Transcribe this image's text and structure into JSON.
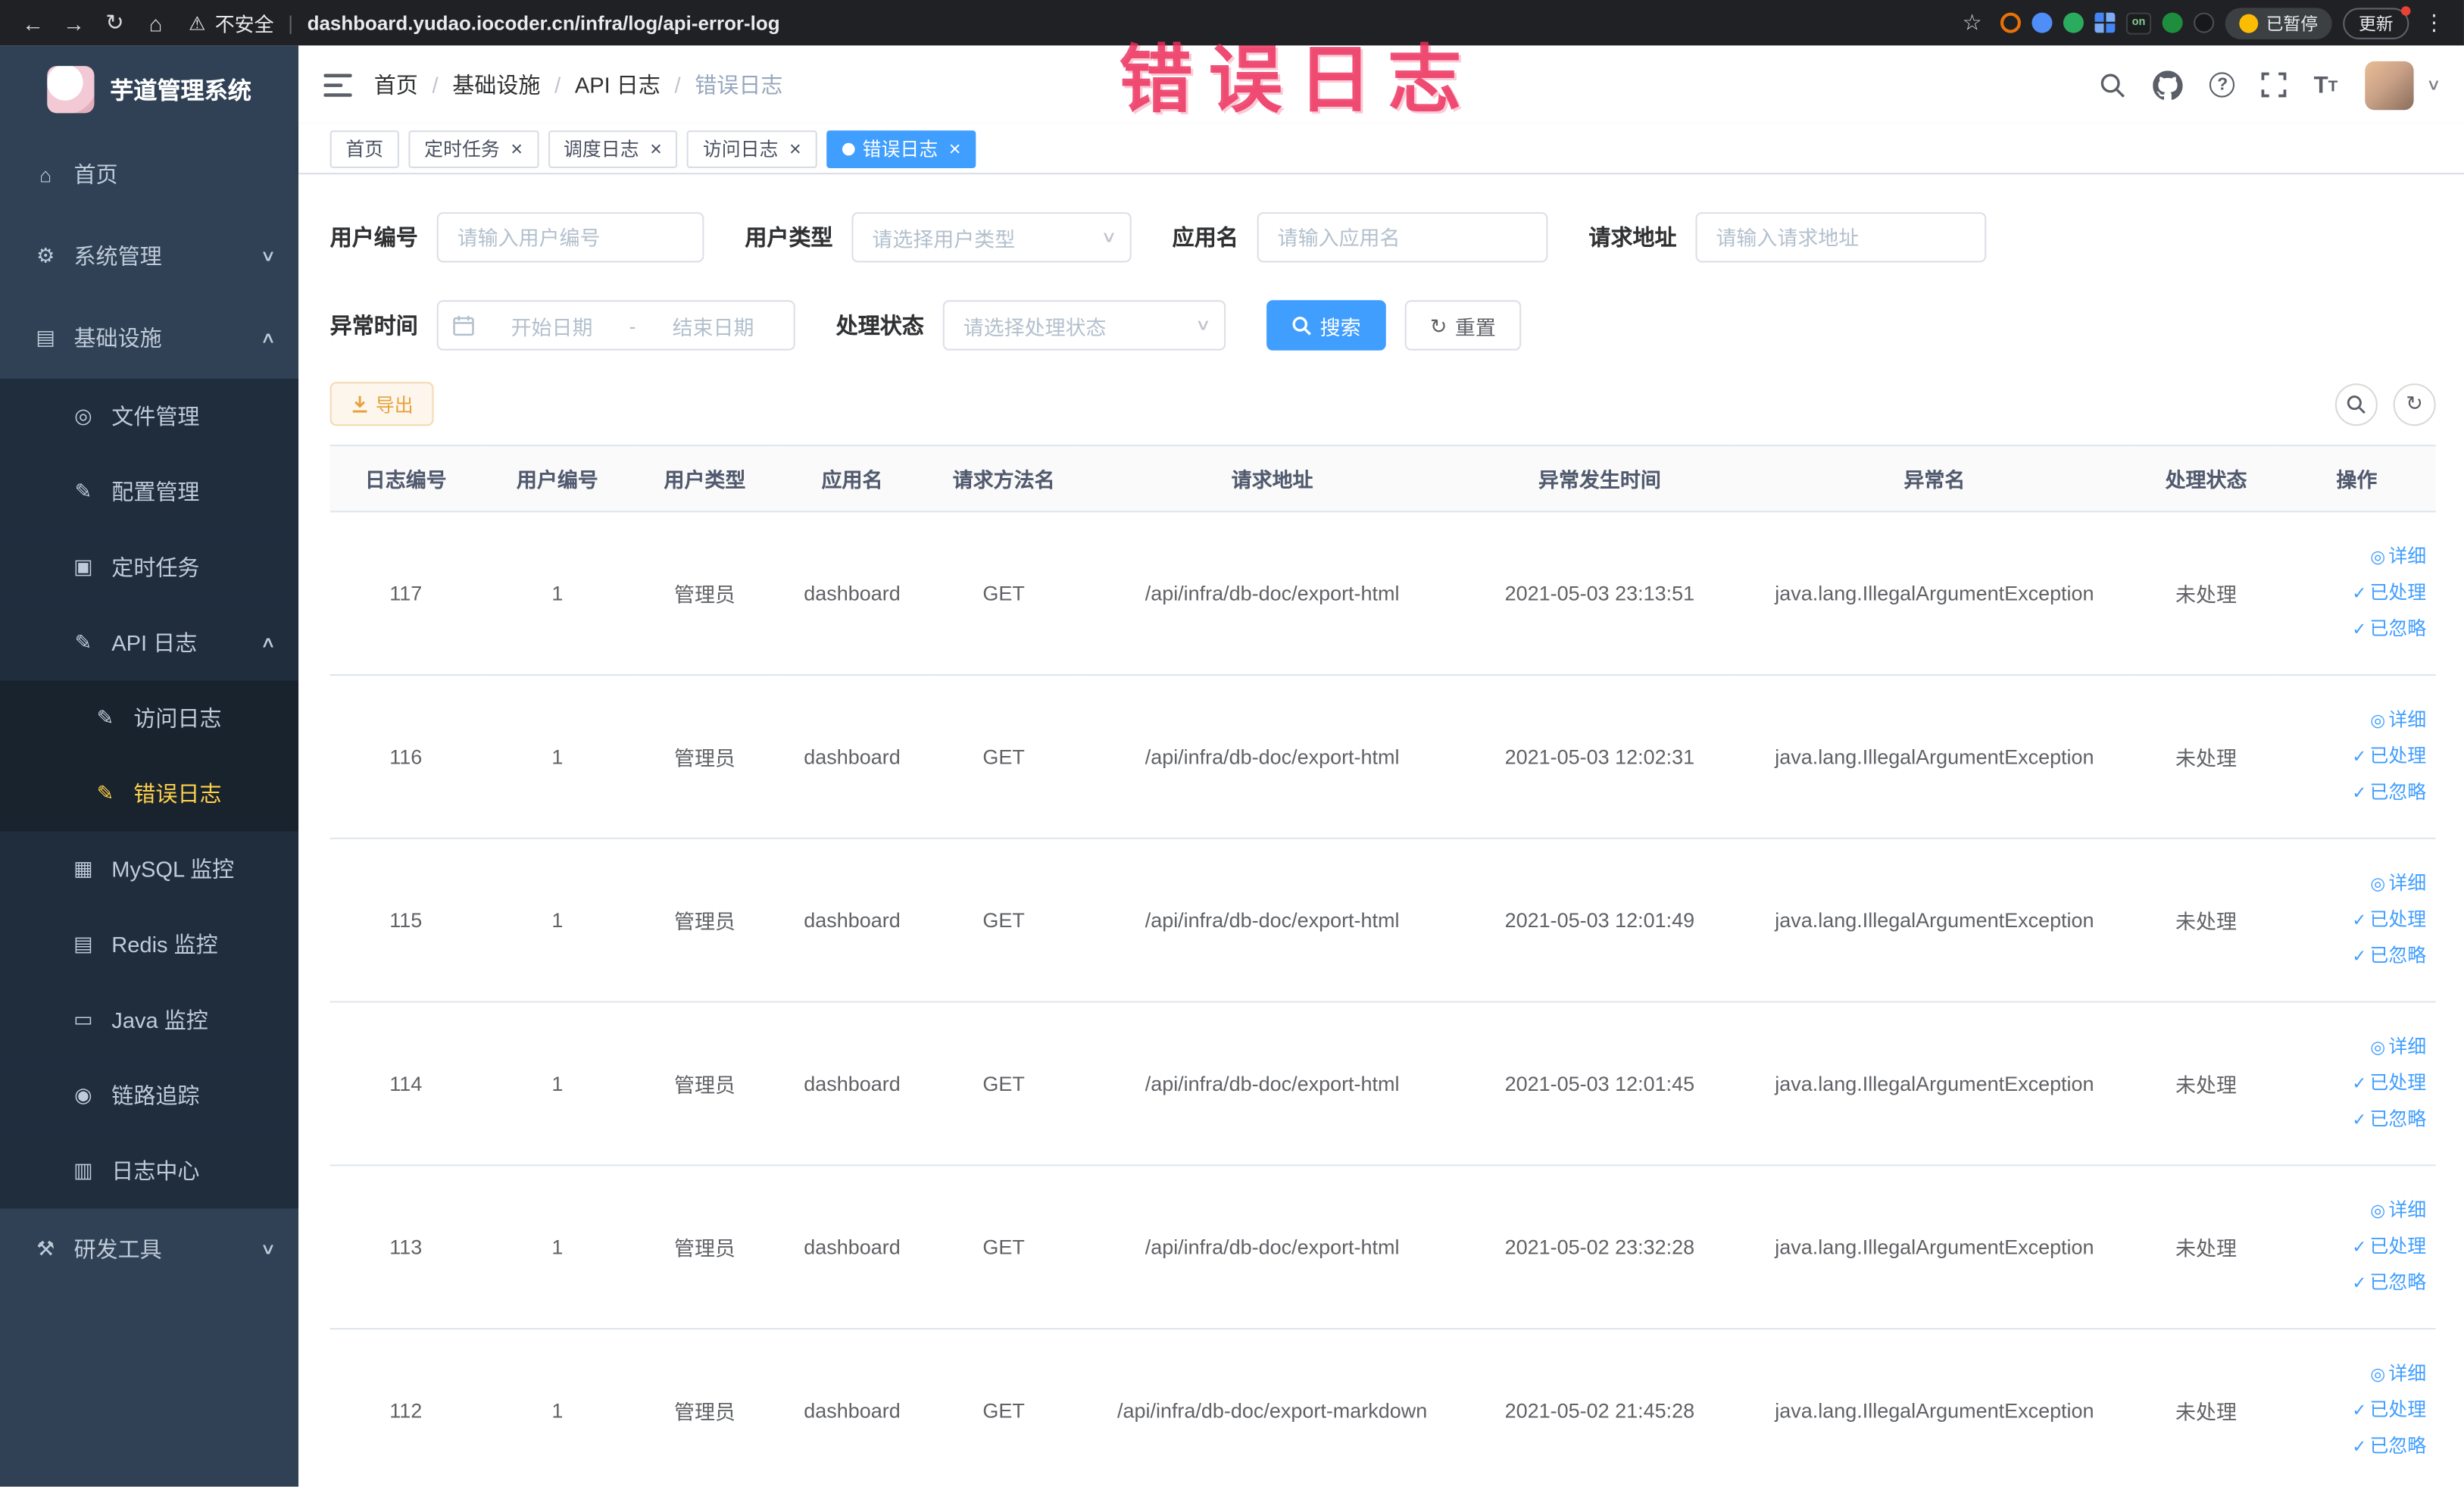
{
  "browser": {
    "security": "不安全",
    "url": "dashboard.yudao.iocoder.cn/infra/log/api-error-log",
    "ext_on": "on",
    "paused": "已暂停",
    "update": "更新"
  },
  "annotation": "错误日志",
  "icons": {
    "back": "←",
    "forward": "→",
    "reload": "↻",
    "home": "⌂",
    "star": "☆",
    "warning": "⚠",
    "divider": "|",
    "kebab": "⋮",
    "caret_down": "∨",
    "caret_up": "∧",
    "close": "×",
    "refresh": "↻",
    "eye": "◎",
    "check": "✓",
    "sidebar": {
      "home": "⌂",
      "system": "⚙",
      "infra": "▤",
      "file": "◎",
      "config": "✎",
      "task": "▣",
      "api": "✎",
      "access": "✎",
      "error": "✎",
      "mysql": "▦",
      "redis": "▤",
      "java": "▭",
      "trace": "◉",
      "logcenter": "▥",
      "tools": "⚒"
    }
  },
  "sidebar": {
    "title": "芋道管理系统",
    "menu": [
      {
        "label": "首页",
        "icon": "home",
        "level": 0
      },
      {
        "label": "系统管理",
        "icon": "system",
        "level": 0,
        "arrow": "down"
      },
      {
        "label": "基础设施",
        "icon": "infra",
        "level": 0,
        "arrow": "up"
      },
      {
        "label": "文件管理",
        "icon": "file",
        "level": 1
      },
      {
        "label": "配置管理",
        "icon": "config",
        "level": 1
      },
      {
        "label": "定时任务",
        "icon": "task",
        "level": 1
      },
      {
        "label": "API 日志",
        "icon": "api",
        "level": 1,
        "arrow": "up"
      },
      {
        "label": "访问日志",
        "icon": "access",
        "level": 2
      },
      {
        "label": "错误日志",
        "icon": "error",
        "level": 2,
        "active": true
      },
      {
        "label": "MySQL 监控",
        "icon": "mysql",
        "level": 1
      },
      {
        "label": "Redis 监控",
        "icon": "redis",
        "level": 1
      },
      {
        "label": "Java 监控",
        "icon": "java",
        "level": 1
      },
      {
        "label": "链路追踪",
        "icon": "trace",
        "level": 1
      },
      {
        "label": "日志中心",
        "icon": "logcenter",
        "level": 1
      },
      {
        "label": "研发工具",
        "icon": "tools",
        "level": 0,
        "arrow": "down"
      }
    ]
  },
  "breadcrumb": [
    "首页",
    "基础设施",
    "API 日志",
    "错误日志"
  ],
  "tags": [
    {
      "label": "首页",
      "closable": false,
      "active": false
    },
    {
      "label": "定时任务",
      "closable": true,
      "active": false
    },
    {
      "label": "调度日志",
      "closable": true,
      "active": false
    },
    {
      "label": "访问日志",
      "closable": true,
      "active": false
    },
    {
      "label": "错误日志",
      "closable": true,
      "active": true
    }
  ],
  "filters": {
    "user_id_label": "用户编号",
    "user_id_placeholder": "请输入用户编号",
    "user_type_label": "用户类型",
    "user_type_placeholder": "请选择用户类型",
    "app_name_label": "应用名",
    "app_name_placeholder": "请输入应用名",
    "request_url_label": "请求地址",
    "request_url_placeholder": "请输入请求地址",
    "exception_time_label": "异常时间",
    "date_start_placeholder": "开始日期",
    "date_separator": "-",
    "date_end_placeholder": "结束日期",
    "process_status_label": "处理状态",
    "process_status_placeholder": "请选择处理状态",
    "search": "搜索",
    "reset": "重置"
  },
  "toolbar": {
    "export": "导出"
  },
  "table": {
    "columns": [
      "日志编号",
      "用户编号",
      "用户类型",
      "应用名",
      "请求方法名",
      "请求地址",
      "异常发生时间",
      "异常名",
      "处理状态",
      "操作"
    ],
    "action_labels": [
      "详细",
      "已处理",
      "已忽略"
    ],
    "rows": [
      {
        "id": "117",
        "user_id": "1",
        "user_type": "管理员",
        "app": "dashboard",
        "method": "GET",
        "url": "/api/infra/db-doc/export-html",
        "time": "2021-05-03 23:13:51",
        "exception": "java.lang.IllegalArgumentException",
        "status": "未处理"
      },
      {
        "id": "116",
        "user_id": "1",
        "user_type": "管理员",
        "app": "dashboard",
        "method": "GET",
        "url": "/api/infra/db-doc/export-html",
        "time": "2021-05-03 12:02:31",
        "exception": "java.lang.IllegalArgumentException",
        "status": "未处理"
      },
      {
        "id": "115",
        "user_id": "1",
        "user_type": "管理员",
        "app": "dashboard",
        "method": "GET",
        "url": "/api/infra/db-doc/export-html",
        "time": "2021-05-03 12:01:49",
        "exception": "java.lang.IllegalArgumentException",
        "status": "未处理"
      },
      {
        "id": "114",
        "user_id": "1",
        "user_type": "管理员",
        "app": "dashboard",
        "method": "GET",
        "url": "/api/infra/db-doc/export-html",
        "time": "2021-05-03 12:01:45",
        "exception": "java.lang.IllegalArgumentException",
        "status": "未处理"
      },
      {
        "id": "113",
        "user_id": "1",
        "user_type": "管理员",
        "app": "dashboard",
        "method": "GET",
        "url": "/api/infra/db-doc/export-html",
        "time": "2021-05-02 23:32:28",
        "exception": "java.lang.IllegalArgumentException",
        "status": "未处理"
      },
      {
        "id": "112",
        "user_id": "1",
        "user_type": "管理员",
        "app": "dashboard",
        "method": "GET",
        "url": "/api/infra/db-doc/export-markdown",
        "time": "2021-05-02 21:45:28",
        "exception": "java.lang.IllegalArgumentException",
        "status": "未处理"
      }
    ]
  },
  "colors": {
    "primary": "#409eff",
    "warning": "#e6a23c",
    "sidebar_bg": "#304156",
    "menu_active": "#ffd04b",
    "annotation": "#ed2d5a"
  }
}
